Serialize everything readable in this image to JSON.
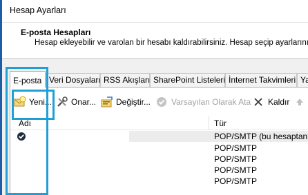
{
  "window": {
    "title": "Hesap Ayarları"
  },
  "header": {
    "section_title": "E-posta Hesapları",
    "description": "Hesap ekleyebilir ve varolan bir hesabı kaldırabilirsiniz. Hesap seçip ayarlarını d"
  },
  "tabs": [
    {
      "label": "E-posta",
      "active": true
    },
    {
      "label": "Veri Dosyaları"
    },
    {
      "label": "RSS Akışları"
    },
    {
      "label": "SharePoint Listeleri"
    },
    {
      "label": "İnternet Takvimleri"
    },
    {
      "label": "Ya"
    }
  ],
  "toolbar": {
    "new": {
      "label": "Yeni...",
      "icon": "new-account-icon"
    },
    "repair": {
      "label": "Onar...",
      "icon": "repair-tools-icon"
    },
    "change": {
      "label": "Değiştir...",
      "icon": "change-account-icon"
    },
    "set_default": {
      "label": "Varsayılan Olarak Ata",
      "icon": "check-circle-icon",
      "enabled": false
    },
    "remove": {
      "label": "Kaldır",
      "icon": "close-icon"
    },
    "move_up": {
      "icon": "arrow-up-icon",
      "enabled": false
    }
  },
  "accounts_table": {
    "columns": [
      "Adı",
      "Tür"
    ],
    "rows": [
      {
        "type": "POP/SMTP (bu hesaptan va",
        "default": true,
        "selected": true
      },
      {
        "type": "POP/SMTP"
      },
      {
        "type": "POP/SMTP"
      },
      {
        "type": "POP/SMTP"
      },
      {
        "type": "POP/SMTP"
      }
    ]
  },
  "colors": {
    "highlight": "#1e9fd6",
    "window_edge": "#1e5ea8"
  }
}
